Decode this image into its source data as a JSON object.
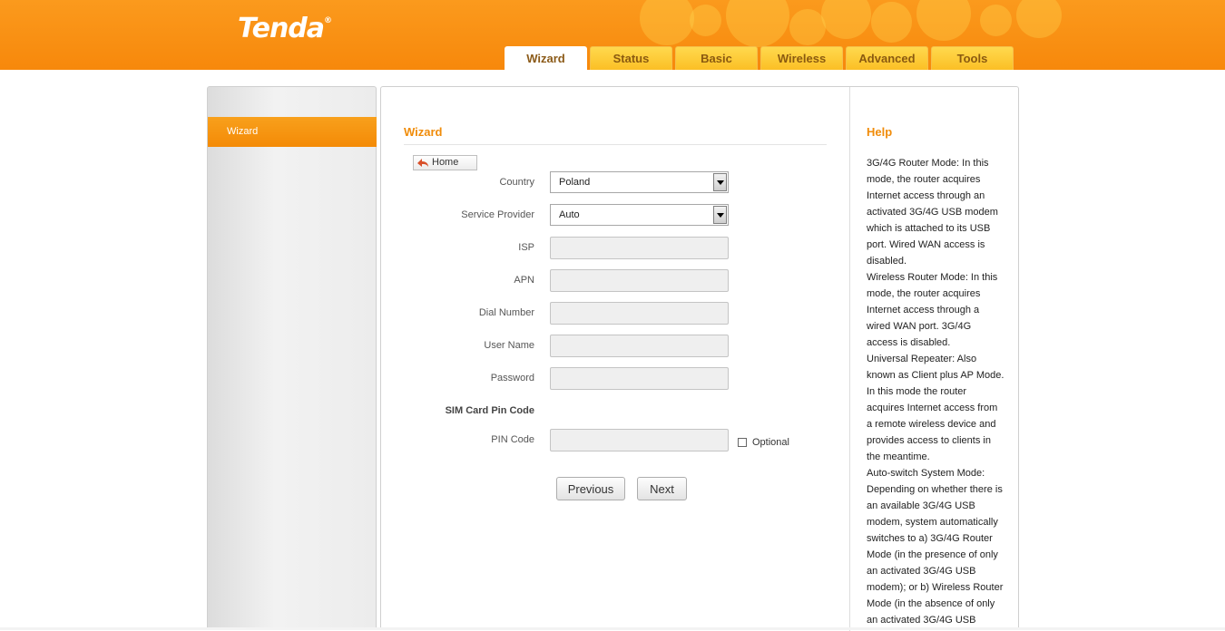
{
  "brand": {
    "logo": "Tenda",
    "mark": "®",
    "color": "#f7880b"
  },
  "nav": {
    "tabs": [
      {
        "label": "Wizard",
        "active": true
      },
      {
        "label": "Status",
        "active": false
      },
      {
        "label": "Basic",
        "active": false
      },
      {
        "label": "Wireless",
        "active": false
      },
      {
        "label": "Advanced",
        "active": false
      },
      {
        "label": "Tools",
        "active": false
      }
    ]
  },
  "sidebar": {
    "items": [
      {
        "label": "Wizard",
        "active": true
      }
    ]
  },
  "wizard": {
    "title": "Wizard",
    "home_label": "Home",
    "country": {
      "label": "Country",
      "value": "Poland"
    },
    "provider": {
      "label": "Service Provider",
      "value": "Auto"
    },
    "isp": {
      "label": "ISP",
      "value": ""
    },
    "apn": {
      "label": "APN",
      "value": ""
    },
    "dial": {
      "label": "Dial Number",
      "value": ""
    },
    "username": {
      "label": "User Name",
      "value": ""
    },
    "password": {
      "label": "Password",
      "value": ""
    },
    "sim_heading": "SIM Card Pin Code",
    "pin": {
      "label": "PIN Code",
      "value": ""
    },
    "optional_label": "Optional",
    "previous_label": "Previous",
    "next_label": "Next"
  },
  "help": {
    "title": "Help",
    "paragraphs": [
      "3G/4G Router Mode: In this mode, the router acquires Internet access through an activated 3G/4G USB modem which is attached to its USB port. Wired WAN access is disabled.",
      "Wireless Router Mode: In this mode, the router acquires Internet access through a wired WAN port. 3G/4G access is disabled.",
      "Universal Repeater: Also known as Client plus AP Mode. In this mode the router acquires Internet access from a remote wireless device and provides access to clients in the meantime.",
      "Auto-switch System Mode: Depending on whether there is an available 3G/4G USB modem, system automatically switches to a) 3G/4G Router Mode (in the presence of only an activated 3G/4G USB modem); or b) Wireless Router Mode (in the absence of only an activated 3G/4G USB"
    ]
  }
}
